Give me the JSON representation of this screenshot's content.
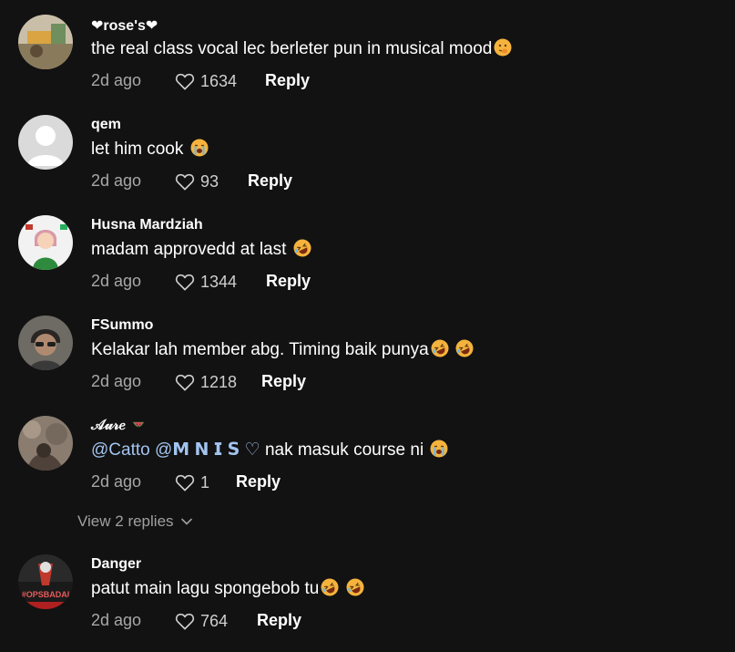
{
  "comments": [
    {
      "username": "❤︎rose's❤︎",
      "text": "the real class vocal lec berleter pun in musical mood",
      "emojis": [
        "shushing-face"
      ],
      "time": "2d ago",
      "likes": "1634",
      "reply_label": "Reply",
      "avatar": "photo-avatar"
    },
    {
      "username": "qem",
      "text": "let him cook",
      "emojis": [
        "loudly-crying-face"
      ],
      "time": "2d ago",
      "likes": "93",
      "reply_label": "Reply",
      "avatar": "default-avatar"
    },
    {
      "username": "Husna Mardziah",
      "text": "madam approvedd at last",
      "emojis": [
        "rofl-face"
      ],
      "time": "2d ago",
      "likes": "1344",
      "reply_label": "Reply",
      "avatar": "cartoon-avatar"
    },
    {
      "username": "FSummo",
      "text": "Kelakar lah member abg. Timing baik punya",
      "emojis": [
        "rofl-face",
        "rofl-face"
      ],
      "time": "2d ago",
      "likes": "1218",
      "reply_label": "Reply",
      "avatar": "photo-avatar"
    },
    {
      "username": "𝒜𝓊𝓇𝑒",
      "username_emoji": "watermelon",
      "mentions": [
        "@Catto",
        "@𝗠 𝗡 𝗜 𝗦 ♡"
      ],
      "text": "nak masuk course ni",
      "emojis": [
        "loudly-crying-face"
      ],
      "time": "2d ago",
      "likes": "1",
      "reply_label": "Reply",
      "avatar": "photo-avatar"
    },
    {
      "username": "Danger",
      "text": "patut main lagu spongebob tu",
      "emojis": [
        "rofl-face",
        "rofl-face"
      ],
      "time": "2d ago",
      "likes": "764",
      "reply_label": "Reply",
      "avatar": "logo-avatar",
      "avatar_text": "#OPSBADAI"
    }
  ],
  "view_replies": {
    "label": "View 2 replies"
  },
  "colors": {
    "background": "#121212",
    "mention": "#a3c4f0",
    "muted": "#a8a8a8"
  }
}
